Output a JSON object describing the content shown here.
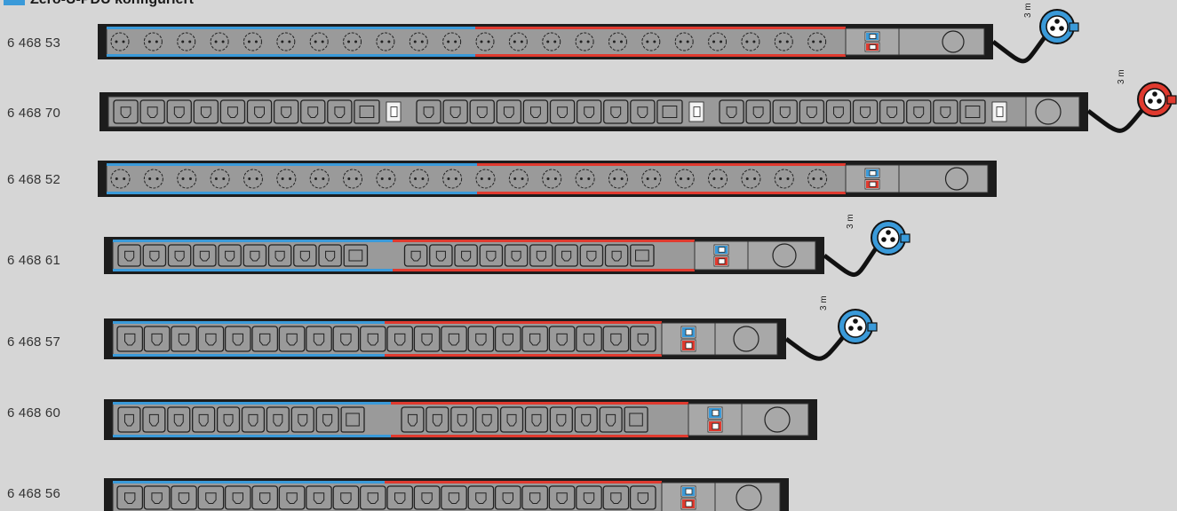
{
  "header": {
    "title": "Zero-U-PDU konfiguriert"
  },
  "cable_label": "3 m",
  "colors": {
    "phase_a": "#3a9ad9",
    "phase_b": "#e03a2f",
    "body": "#9a9a9a",
    "frame": "#1c1c1c",
    "background": "#d6d6d6"
  },
  "rows": [
    {
      "label": "6 468 53",
      "socket_type": "schuko",
      "cable": true,
      "plug_color": "blue",
      "sections": 2
    },
    {
      "label": "6 468 70",
      "socket_type": "c13-c19",
      "cable": true,
      "plug_color": "red",
      "sections": 3
    },
    {
      "label": "6 468 52",
      "socket_type": "schuko",
      "cable": false,
      "sections": 2
    },
    {
      "label": "6 468 61",
      "socket_type": "c13-c19",
      "cable": true,
      "plug_color": "blue",
      "sections": 2
    },
    {
      "label": "6 468 57",
      "socket_type": "c13",
      "cable": true,
      "plug_color": "blue",
      "sections": 2
    },
    {
      "label": "6 468 60",
      "socket_type": "c13-c19",
      "cable": false,
      "sections": 2
    },
    {
      "label": "6 468 56",
      "socket_type": "c13",
      "cable": false,
      "sections": 2
    }
  ]
}
